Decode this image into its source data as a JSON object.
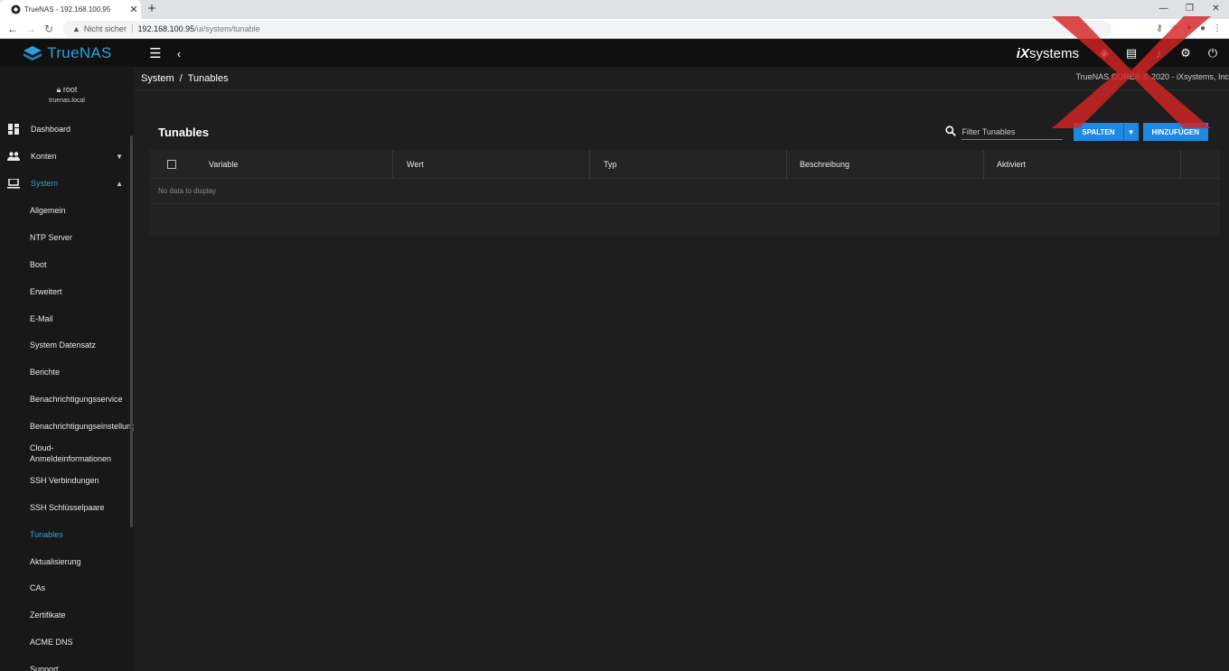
{
  "browser": {
    "tab_title": "TrueNAS - 192.168.100.95",
    "security_label": "Nicht sicher",
    "url_host": "192.168.100.95",
    "url_path": "/ui/system/tunable"
  },
  "app": {
    "logo_text": "TrueNAS",
    "vendor_logo": "systems",
    "copyright": "TrueNAS CORE® © 2020 - iXsystems, Inc"
  },
  "user": {
    "name": "root",
    "host": "truenas.local"
  },
  "sidebar": {
    "items": [
      {
        "label": "Dashboard",
        "icon": "dashboard-icon"
      },
      {
        "label": "Konten",
        "icon": "people-icon"
      },
      {
        "label": "System",
        "icon": "laptop-icon"
      }
    ],
    "system_sub": [
      "Allgemein",
      "NTP Server",
      "Boot",
      "Erweitert",
      "E-Mail",
      "System Datensatz",
      "Berichte",
      "Benachrichtigungsservice",
      "Benachrichtigungseinstellungen",
      "Cloud-Anmeldeinformationen",
      "SSH Verbindungen",
      "SSH Schlüsselpaare",
      "Tunables",
      "Aktualisierung",
      "CAs",
      "Zertifikate",
      "ACME DNS",
      "Support"
    ]
  },
  "breadcrumb": {
    "parent": "System",
    "separator": "/",
    "current": "Tunables"
  },
  "page": {
    "title": "Tunables",
    "filter_placeholder": "Filter Tunables",
    "columns_button": "SPALTEN",
    "add_button": "HINZUFÜGEN"
  },
  "table": {
    "columns": [
      "Variable",
      "Wert",
      "Typ",
      "Beschreibung",
      "Aktiviert"
    ],
    "empty_message": "No data to display"
  },
  "colors": {
    "accent": "#2b9fe0",
    "button": "#1e88e5",
    "background": "#1e1e1e",
    "topbar": "#101010",
    "sidebar": "#181818"
  }
}
